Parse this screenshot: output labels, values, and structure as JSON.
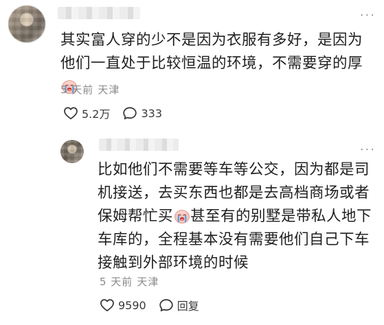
{
  "comments": [
    {
      "text_before_emoji": "其实富人穿的少不是因为衣服有多好，是因为他们一直处于比较恒温的环境，不需要穿的厚",
      "text_after_emoji": "",
      "emoji": "crying-face",
      "meta": {
        "time": "5 天前",
        "location": "天津"
      },
      "likes": "5.2万",
      "replies": "333",
      "more_icon": "more-dots"
    }
  ],
  "reply": {
    "text_before_emoji": "比如他们不需要等车等公交，因为都是司机接送，去买东西也都是去高档商场或者保姆帮忙买",
    "text_after_emoji": "甚至有的别墅是带私人地下车库的，全程基本没有需要他们自己下车接触到外部环境的时候",
    "emoji": "crying-face",
    "meta": {
      "time": "5 天前",
      "location": "天津"
    },
    "likes": "9590",
    "reply_label": "回复",
    "more_icon": "more-dots"
  },
  "icons": {
    "like": "heart-icon",
    "comment": "speech-bubble-icon",
    "more": "more-dots-icon"
  },
  "colors": {
    "text": "#1f1f1f",
    "meta": "#8a8a8a",
    "icon": "#3a3a3a"
  }
}
